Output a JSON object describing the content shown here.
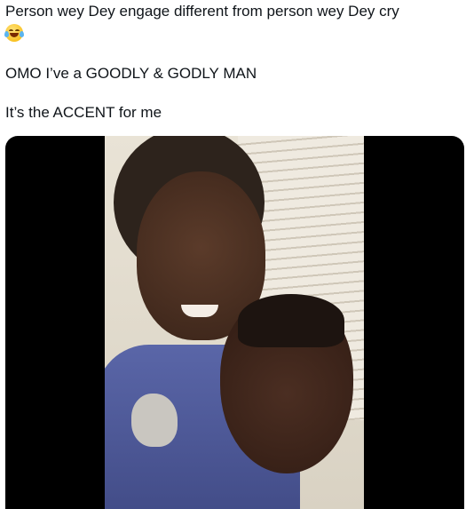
{
  "tweet": {
    "line1": "Person wey Dey engage different from person wey Dey cry",
    "emoji": "face-with-tears-of-joy",
    "line2": "OMO I’ve a GOODLY & GODLY MAN",
    "line3": "It’s the ACCENT for me"
  },
  "media": {
    "type": "video"
  }
}
